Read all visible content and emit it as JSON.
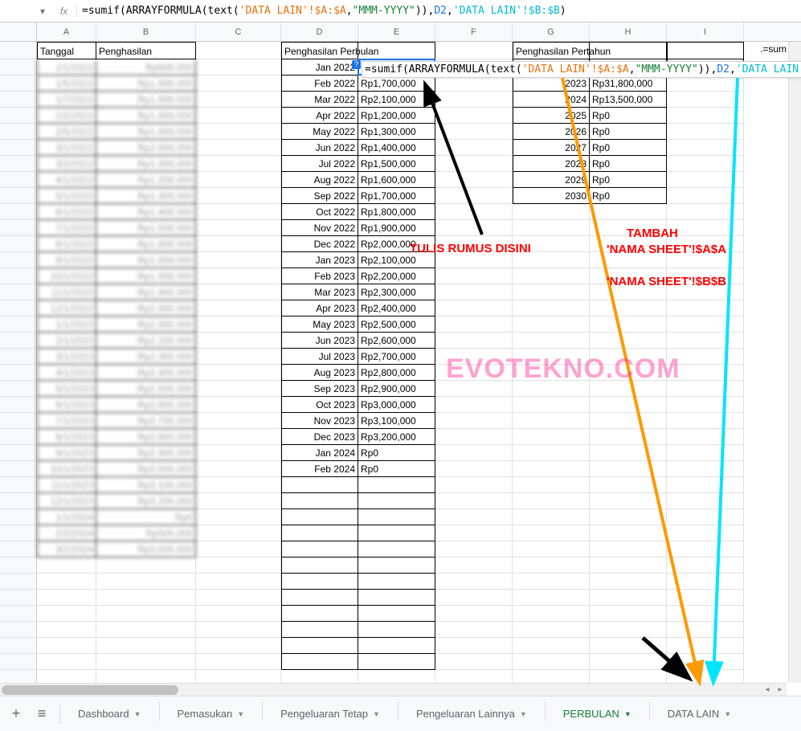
{
  "formula_bar": {
    "name_box": "",
    "fx_label": "fx",
    "formula_prefix": "=sumif(",
    "formula_arrayfunc": "ARRAYFORMULA",
    "formula_open2": "(",
    "formula_textfunc": "text",
    "formula_open3": "(",
    "formula_ref1": "'DATA LAIN'!$A:$A",
    "formula_comma1": ",",
    "formula_string": "\"MMM-YYYY\"",
    "formula_close2": ")),",
    "formula_ref2": "D2",
    "formula_comma2": ",",
    "formula_ref3": "'DATA LAIN'!$B:$B",
    "formula_close": ")"
  },
  "columns": {
    "A": "A",
    "B": "B",
    "C": "C",
    "D": "D",
    "E": "E",
    "F": "F",
    "G": "G",
    "H": "H",
    "I": "I"
  },
  "headers": {
    "A": "Tanggal",
    "B": "Penghasilan",
    "D": "Penghasilan Perbulan",
    "G": "Penghasilan Pertahun",
    "I_overflow": ".=sum"
  },
  "col_AB": [
    {
      "a": "1/1/2022",
      "b": "Rp500.000"
    },
    {
      "a": "1/5/2022",
      "b": "Rp1.000.000"
    },
    {
      "a": "1/7/2022",
      "b": "Rp1.000.000"
    },
    {
      "a": "2/2/2022",
      "b": "Rp1.000.000"
    },
    {
      "a": "2/5/2022",
      "b": "Rp1.000.000"
    },
    {
      "a": "3/1/2022",
      "b": "Rp2.000.000"
    },
    {
      "a": "3/2/2022",
      "b": "Rp1.000.000"
    },
    {
      "a": "4/1/2022",
      "b": "Rp1.200.000"
    },
    {
      "a": "5/1/2022",
      "b": "Rp1.300.000"
    },
    {
      "a": "6/1/2022",
      "b": "Rp1.400.000"
    },
    {
      "a": "7/1/2022",
      "b": "Rp1.500.000"
    },
    {
      "a": "8/1/2022",
      "b": "Rp1.600.000"
    },
    {
      "a": "9/1/2022",
      "b": "Rp1.000.000"
    },
    {
      "a": "10/1/2022",
      "b": "Rp1.000.000"
    },
    {
      "a": "11/1/2022",
      "b": "Rp1.900.000"
    },
    {
      "a": "12/1/2022",
      "b": "Rp2.000.000"
    },
    {
      "a": "1/1/2023",
      "b": "Rp2.000.000"
    },
    {
      "a": "2/1/2023",
      "b": "Rp2.200.000"
    },
    {
      "a": "3/1/2023",
      "b": "Rp2.300.000"
    },
    {
      "a": "4/1/2023",
      "b": "Rp2.400.000"
    },
    {
      "a": "5/1/2023",
      "b": "Rp2.500.000"
    },
    {
      "a": "6/1/2023",
      "b": "Rp2.600.000"
    },
    {
      "a": "7/1/2023",
      "b": "Rp2.700.000"
    },
    {
      "a": "8/1/2023",
      "b": "Rp2.800.000"
    },
    {
      "a": "9/1/2023",
      "b": "Rp2.900.000"
    },
    {
      "a": "10/1/2023",
      "b": "Rp3.000.000"
    },
    {
      "a": "11/1/2023",
      "b": "Rp3.100.000"
    },
    {
      "a": "12/1/2023",
      "b": "Rp3.200.000"
    },
    {
      "a": "1/1/2024",
      "b": "Rp0"
    },
    {
      "a": "2/2/2024",
      "b": "Rp500.000"
    },
    {
      "a": "3/2/2024",
      "b": "Rp3.000.000"
    }
  ],
  "col_DE": [
    {
      "d": "Jan 2022",
      "e": ""
    },
    {
      "d": "Feb 2022",
      "e": "Rp1,700,000"
    },
    {
      "d": "Mar 2022",
      "e": "Rp2,100,000"
    },
    {
      "d": "Apr 2022",
      "e": "Rp1,200,000"
    },
    {
      "d": "May 2022",
      "e": "Rp1,300,000"
    },
    {
      "d": "Jun 2022",
      "e": "Rp1,400,000"
    },
    {
      "d": "Jul 2022",
      "e": "Rp1,500,000"
    },
    {
      "d": "Aug 2022",
      "e": "Rp1,600,000"
    },
    {
      "d": "Sep 2022",
      "e": "Rp1,700,000"
    },
    {
      "d": "Oct 2022",
      "e": "Rp1,800,000"
    },
    {
      "d": "Nov 2022",
      "e": "Rp1,900,000"
    },
    {
      "d": "Dec 2022",
      "e": "Rp2,000,000"
    },
    {
      "d": "Jan 2023",
      "e": "Rp2,100,000"
    },
    {
      "d": "Feb 2023",
      "e": "Rp2,200,000"
    },
    {
      "d": "Mar 2023",
      "e": "Rp2,300,000"
    },
    {
      "d": "Apr 2023",
      "e": "Rp2,400,000"
    },
    {
      "d": "May 2023",
      "e": "Rp2,500,000"
    },
    {
      "d": "Jun 2023",
      "e": "Rp2,600,000"
    },
    {
      "d": "Jul 2023",
      "e": "Rp2,700,000"
    },
    {
      "d": "Aug 2023",
      "e": "Rp2,800,000"
    },
    {
      "d": "Sep 2023",
      "e": "Rp2,900,000"
    },
    {
      "d": "Oct 2023",
      "e": "Rp3,000,000"
    },
    {
      "d": "Nov 2023",
      "e": "Rp3,100,000"
    },
    {
      "d": "Dec 2023",
      "e": "Rp3,200,000"
    },
    {
      "d": "Jan 2024",
      "e": "Rp0"
    },
    {
      "d": "Feb 2024",
      "e": "Rp0"
    }
  ],
  "col_GH": [
    {
      "g": "",
      "h": ""
    },
    {
      "g": "2023",
      "h": "Rp31,800,000"
    },
    {
      "g": "2024",
      "h": "Rp13,500,000"
    },
    {
      "g": "2025",
      "h": "Rp0"
    },
    {
      "g": "2026",
      "h": "Rp0"
    },
    {
      "g": "2027",
      "h": "Rp0"
    },
    {
      "g": "2028",
      "h": "Rp0"
    },
    {
      "g": "2029",
      "h": "Rp0"
    },
    {
      "g": "2030",
      "h": "Rp0"
    }
  ],
  "popup": {
    "prefix": "=sumif(",
    "arrayfunc": "ARRAYFORMULA",
    "open2": "(",
    "textfunc": "text",
    "open3": "(",
    "ref1": "'DATA LAIN'!$A:$A",
    "comma1": ",",
    "string": "\"MMM-YYYY\"",
    "close2": ")),",
    "ref2": "D2",
    "comma2": ",",
    "ref3": "'DATA LAIN'!$B:$B",
    "close": ")",
    "hint": "?"
  },
  "annotations": {
    "tulis": "TULIS RUMUS DISINI",
    "tambah": "TAMBAH",
    "asa": "'NAMA SHEET'!$A$A",
    "bsb": "'NAMA SHEET'!$B$B",
    "watermark": "EVOTEKNO.COM"
  },
  "tabs": {
    "add": "+",
    "menu": "≡",
    "items": [
      {
        "label": "Dashboard",
        "active": false
      },
      {
        "label": "Pemasukan",
        "active": false
      },
      {
        "label": "Pengeluaran Tetap",
        "active": false
      },
      {
        "label": "Pengeluaran Lainnya",
        "active": false
      },
      {
        "label": "PERBULAN",
        "active": true
      },
      {
        "label": "DATA LAIN",
        "active": false
      }
    ]
  }
}
